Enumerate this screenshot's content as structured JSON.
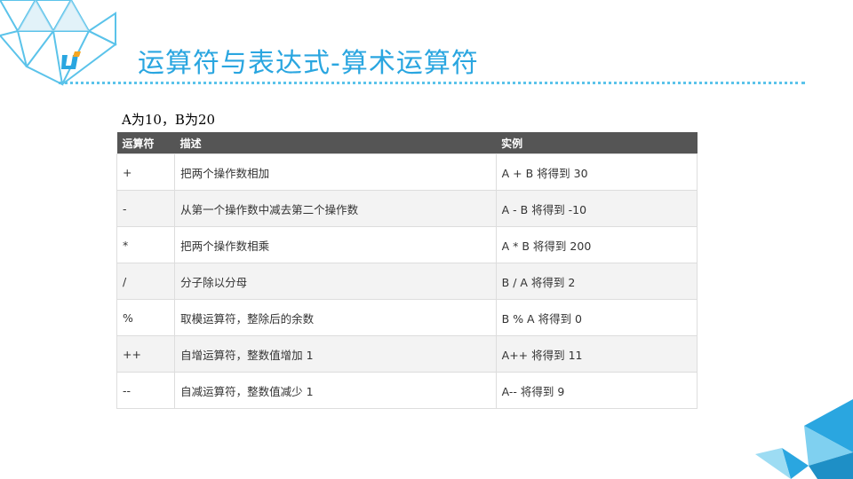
{
  "header": {
    "title": "运算符与表达式-算术运算符",
    "logo_text": "U"
  },
  "subtitle": "A为10，B为20",
  "table": {
    "columns": [
      "运算符",
      "描述",
      "实例"
    ],
    "rows": [
      [
        "+",
        "把两个操作数相加",
        "A + B 将得到 30"
      ],
      [
        "-",
        "从第一个操作数中减去第二个操作数",
        "A - B 将得到 -10"
      ],
      [
        "*",
        "把两个操作数相乘",
        "A * B 将得到 200"
      ],
      [
        "/",
        "分子除以分母",
        "B / A 将得到 2"
      ],
      [
        "%",
        "取模运算符，整除后的余数",
        "B % A 将得到 0"
      ],
      [
        "++",
        "自增运算符，整数值增加 1",
        "A++ 将得到 11"
      ],
      [
        "--",
        "自减运算符，整数值减少 1",
        "A-- 将得到 9"
      ]
    ]
  },
  "colors": {
    "accent": "#2aa6e0",
    "header_bg": "#555555",
    "alt_row": "#f3f3f3"
  }
}
